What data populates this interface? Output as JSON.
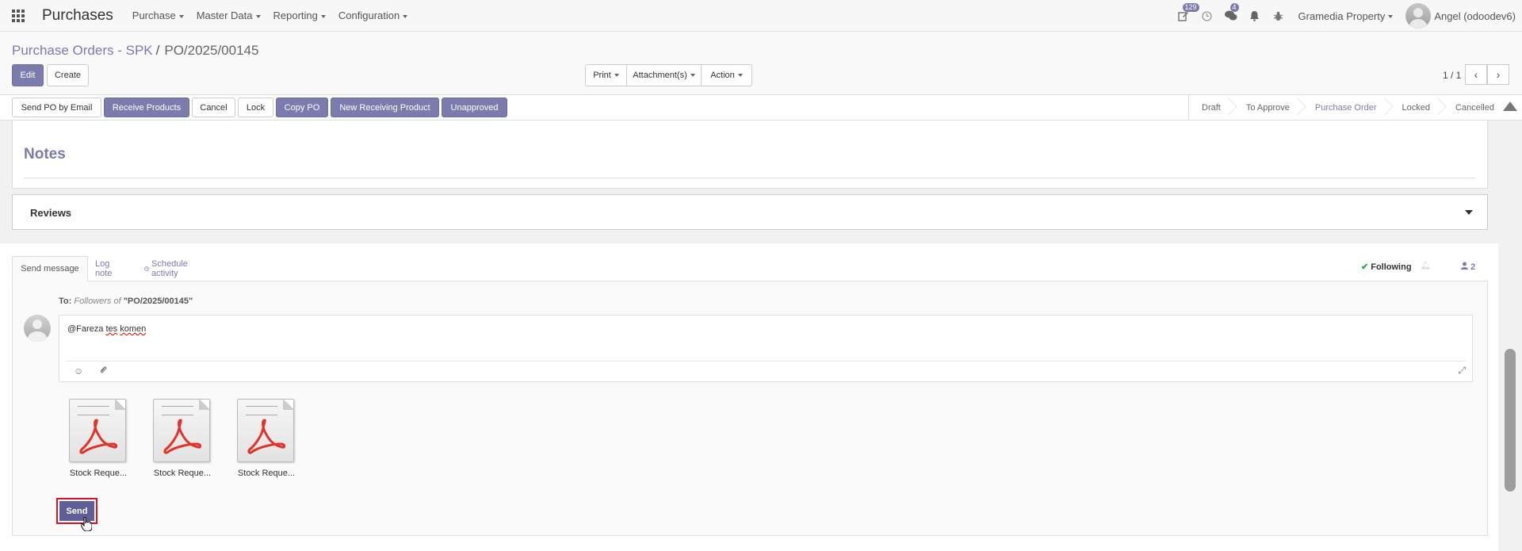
{
  "navbar": {
    "app_title": "Purchases",
    "menus": [
      "Purchase",
      "Master Data",
      "Reporting",
      "Configuration"
    ],
    "badges": {
      "activities": "129",
      "messages": "4"
    },
    "company": "Gramedia Property",
    "user": "Angel (odoodev6)"
  },
  "breadcrumb": {
    "parent": "Purchase Orders - SPK",
    "current": "PO/2025/00145"
  },
  "control": {
    "edit": "Edit",
    "create": "Create",
    "print": "Print",
    "attachments": "Attachment(s)",
    "action": "Action",
    "pager": "1 / 1"
  },
  "status_buttons": {
    "send_po": "Send PO by Email",
    "receive": "Receive Products",
    "cancel": "Cancel",
    "lock": "Lock",
    "copy_po": "Copy PO",
    "new_receiving": "New Receiving Product",
    "unapproved": "Unapproved"
  },
  "stages": [
    "Draft",
    "To Approve",
    "Purchase Order",
    "Locked",
    "Cancelled"
  ],
  "active_stage": "Purchase Order",
  "sheet": {
    "notes_title": "Notes",
    "reviews_title": "Reviews"
  },
  "chatter": {
    "tabs": {
      "send_message": "Send message",
      "log_note": "Log note",
      "schedule": "Schedule activity"
    },
    "following": "Following",
    "followers_count": "2",
    "to_label": "To:",
    "to_followers": "Followers of",
    "to_record": "\"PO/2025/00145\"",
    "message_mention": "@Fareza",
    "message_word1": "tes",
    "message_word2": "komen",
    "attachments": [
      "Stock Reque...",
      "Stock Reque...",
      "Stock Reque..."
    ],
    "send": "Send"
  },
  "colors": {
    "primary": "#7c7bad",
    "send_highlight": "#d9141c"
  }
}
